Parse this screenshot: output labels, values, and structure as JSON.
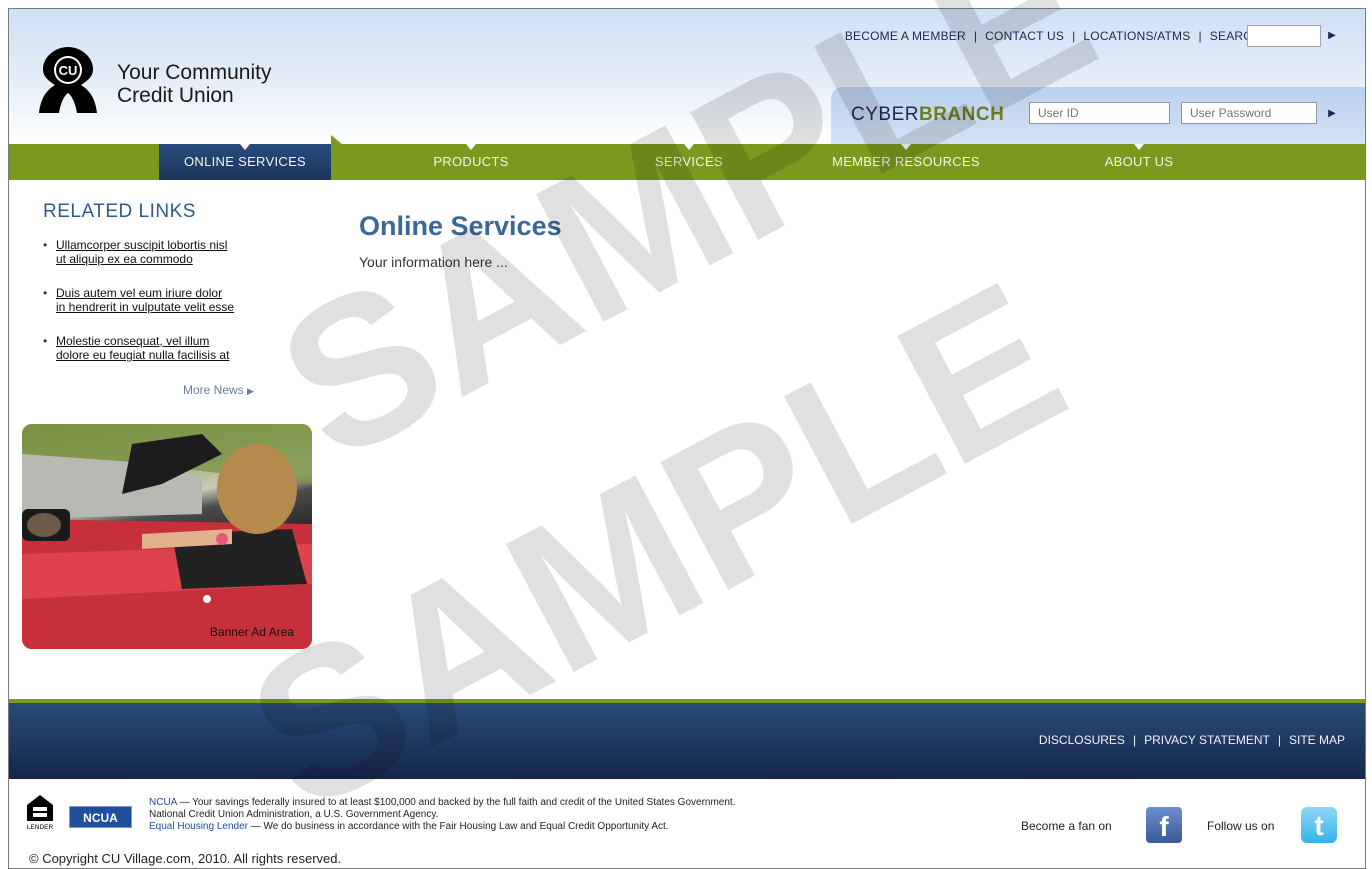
{
  "brand": {
    "logo_mark": "CU",
    "name_line1": "Your Community",
    "name_line2": "Credit Union"
  },
  "top_links": {
    "become_member": "BECOME A MEMBER",
    "contact_us": "CONTACT US",
    "locations": "LOCATIONS/ATMS",
    "search": "SEARCH",
    "separator": "|"
  },
  "cyberbranch": {
    "label_part1": "CYBER",
    "label_part2": "BRANCH",
    "user_id_placeholder": "User ID",
    "password_placeholder": "User Password"
  },
  "nav": {
    "items": [
      {
        "label": "ONLINE SERVICES",
        "active": true
      },
      {
        "label": "PRODUCTS"
      },
      {
        "label": "SERVICES"
      },
      {
        "label": "MEMBER RESOURCES"
      },
      {
        "label": "ABOUT US"
      }
    ]
  },
  "sidebar": {
    "title": "RELATED LINKS",
    "links": [
      {
        "line1": "Ullamcorper suscipit lobortis nisl",
        "line2": "ut aliquip ex ea commodo"
      },
      {
        "line1": "Duis autem vel eum iriure dolor",
        "line2": "in hendrerit in vulputate velit esse"
      },
      {
        "line1": "Molestie consequat, vel illum",
        "line2": "dolore eu feugiat nulla facilisis at"
      }
    ],
    "more_news": "More News",
    "banner_label": "Banner Ad Area"
  },
  "main": {
    "title": "Online Services",
    "body": "Your information here ..."
  },
  "footer": {
    "disclosures": "DISCLOSURES",
    "privacy": "PRIVACY STATEMENT",
    "site_map": "SITE MAP",
    "separator": "|"
  },
  "legal": {
    "ehl_text": "LENDER",
    "ncua_logo": "NCUA",
    "ncua_link": "NCUA",
    "ncua_text": " — Your savings federally insured to at least $100,000 and backed by the full faith and credit of the United States Government.",
    "ncua_line2": "National Credit Union Administration, a U.S. Government Agency.",
    "ehl_link": "Equal Housing Lender",
    "ehl_statement": " — We do business in accordance with the Fair Housing Law and Equal Credit Opportunity Act.",
    "copyright": "© Copyright CU Village.com, 2010. All rights reserved."
  },
  "social": {
    "fan_text": "Become a fan on",
    "follow_text": "Follow us on",
    "facebook_icon": "f",
    "twitter_icon": "t"
  },
  "watermark": {
    "text": "SAMPLE"
  },
  "colors": {
    "nav_green": "#7a9a1e",
    "nav_active_blue": "#294b7d",
    "title_blue": "#3a6899",
    "footer_navy": "#1a355c"
  }
}
